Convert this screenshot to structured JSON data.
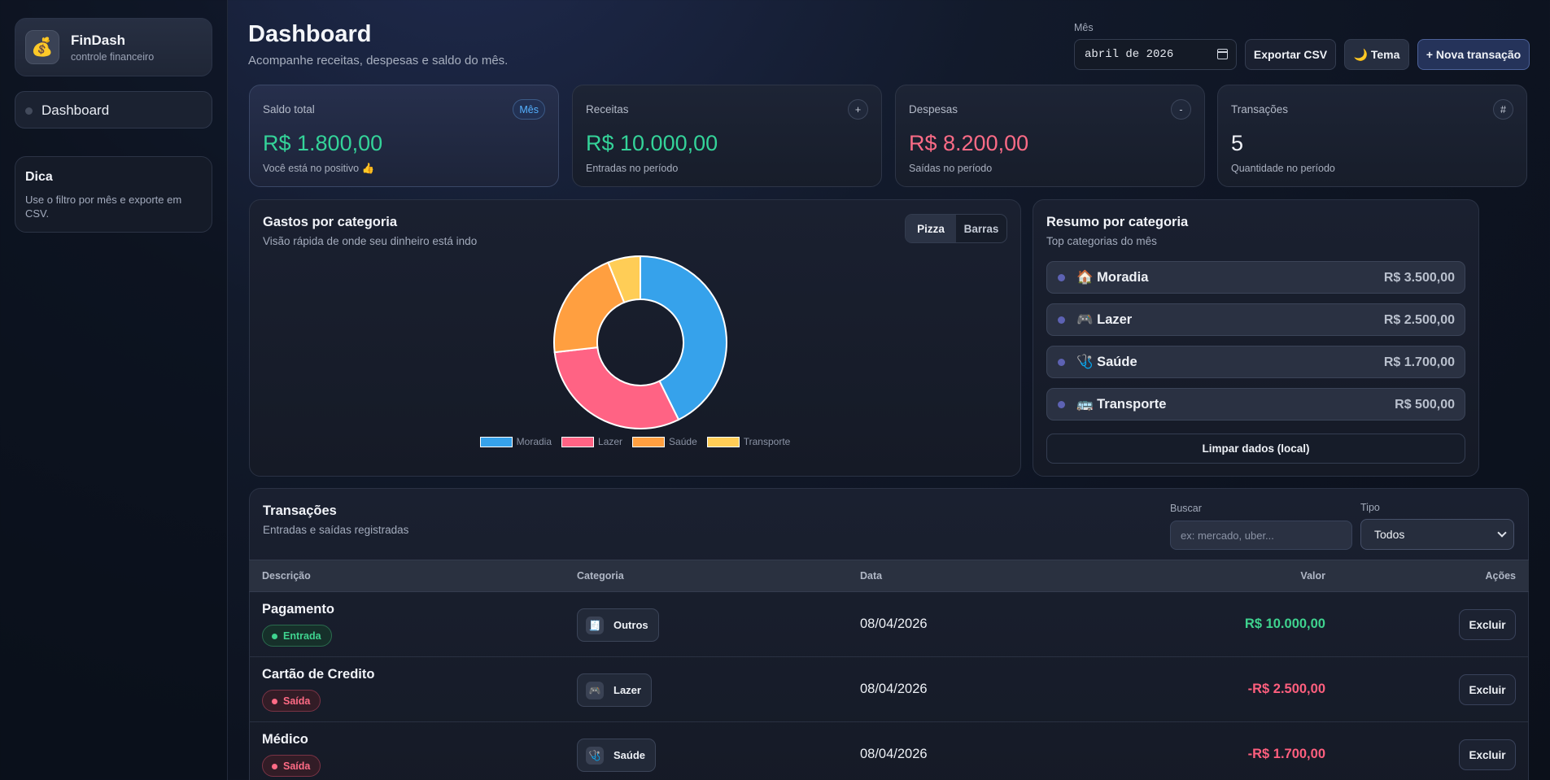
{
  "brand": {
    "icon": "money-bag-icon",
    "glyph": "💰",
    "name": "FinDash",
    "subtitle": "controle financeiro"
  },
  "sidebar": {
    "items": [
      {
        "label": "Dashboard"
      }
    ]
  },
  "tip": {
    "title": "Dica",
    "text": "Use o filtro por mês e exporte em CSV."
  },
  "header": {
    "title": "Dashboard",
    "subtitle": "Acompanhe receitas, despesas e saldo do mês.",
    "month_label": "Mês",
    "month_value": "abril de 2026",
    "export_label": "Exportar CSV",
    "theme_label": "🌙 Tema",
    "new_label": "+ Nova transação"
  },
  "stats": [
    {
      "label": "Saldo total",
      "badge": "Mês",
      "value": "R$ 1.800,00",
      "note": "Você está no positivo 👍",
      "color": "#34d399"
    },
    {
      "label": "Receitas",
      "badge": "+",
      "value": "R$ 10.000,00",
      "note": "Entradas no período",
      "color": "#34d399"
    },
    {
      "label": "Despesas",
      "badge": "-",
      "value": "R$ 8.200,00",
      "note": "Saídas no período",
      "color": "#fb6b86"
    },
    {
      "label": "Transações",
      "badge": "#",
      "value": "5",
      "note": "Quantidade no período",
      "color": "#f1f3f8"
    }
  ],
  "chart_panel": {
    "title": "Gastos por categoria",
    "subtitle": "Visão rápida de onde seu dinheiro está indo",
    "toggle": {
      "pie_label": "Pizza",
      "bar_label": "Barras"
    }
  },
  "chart_data": {
    "type": "pie",
    "donut": true,
    "categories": [
      "Moradia",
      "Lazer",
      "Saúde",
      "Transporte"
    ],
    "values": [
      3500,
      2500,
      1700,
      500
    ],
    "colors": [
      "#36a2eb",
      "#ff6384",
      "#ff9f40",
      "#ffcd56"
    ],
    "legend": "bottom"
  },
  "summary": {
    "title": "Resumo por categoria",
    "subtitle": "Top categorias do mês",
    "items": [
      {
        "name": "🏠 Moradia",
        "amount": "R$ 3.500,00"
      },
      {
        "name": "🎮 Lazer",
        "amount": "R$ 2.500,00"
      },
      {
        "name": "🩺 Saúde",
        "amount": "R$ 1.700,00"
      },
      {
        "name": "🚌 Transporte",
        "amount": "R$ 500,00"
      }
    ],
    "clear_label": "Limpar dados (local)"
  },
  "transactions": {
    "title": "Transações",
    "subtitle": "Entradas e saídas registradas",
    "search_label": "Buscar",
    "search_placeholder": "ex: mercado, uber...",
    "type_label": "Tipo",
    "type_value": "Todos",
    "columns": [
      "Descrição",
      "Categoria",
      "Data",
      "Valor",
      "Ações"
    ],
    "rows": [
      {
        "description": "Pagamento",
        "type": "Entrada",
        "category": "Outros",
        "category_icon": "🧾",
        "date": "08/04/2026",
        "value": "R$ 10.000,00",
        "delete_label": "Excluir"
      },
      {
        "description": "Cartão de Credito",
        "type": "Saída",
        "category": "Lazer",
        "category_icon": "🎮",
        "date": "08/04/2026",
        "value": "-R$ 2.500,00",
        "delete_label": "Excluir"
      },
      {
        "description": "Médico",
        "type": "Saída",
        "category": "Saúde",
        "category_icon": "🩺",
        "date": "08/04/2026",
        "value": "-R$ 1.700,00",
        "delete_label": "Excluir"
      }
    ]
  }
}
